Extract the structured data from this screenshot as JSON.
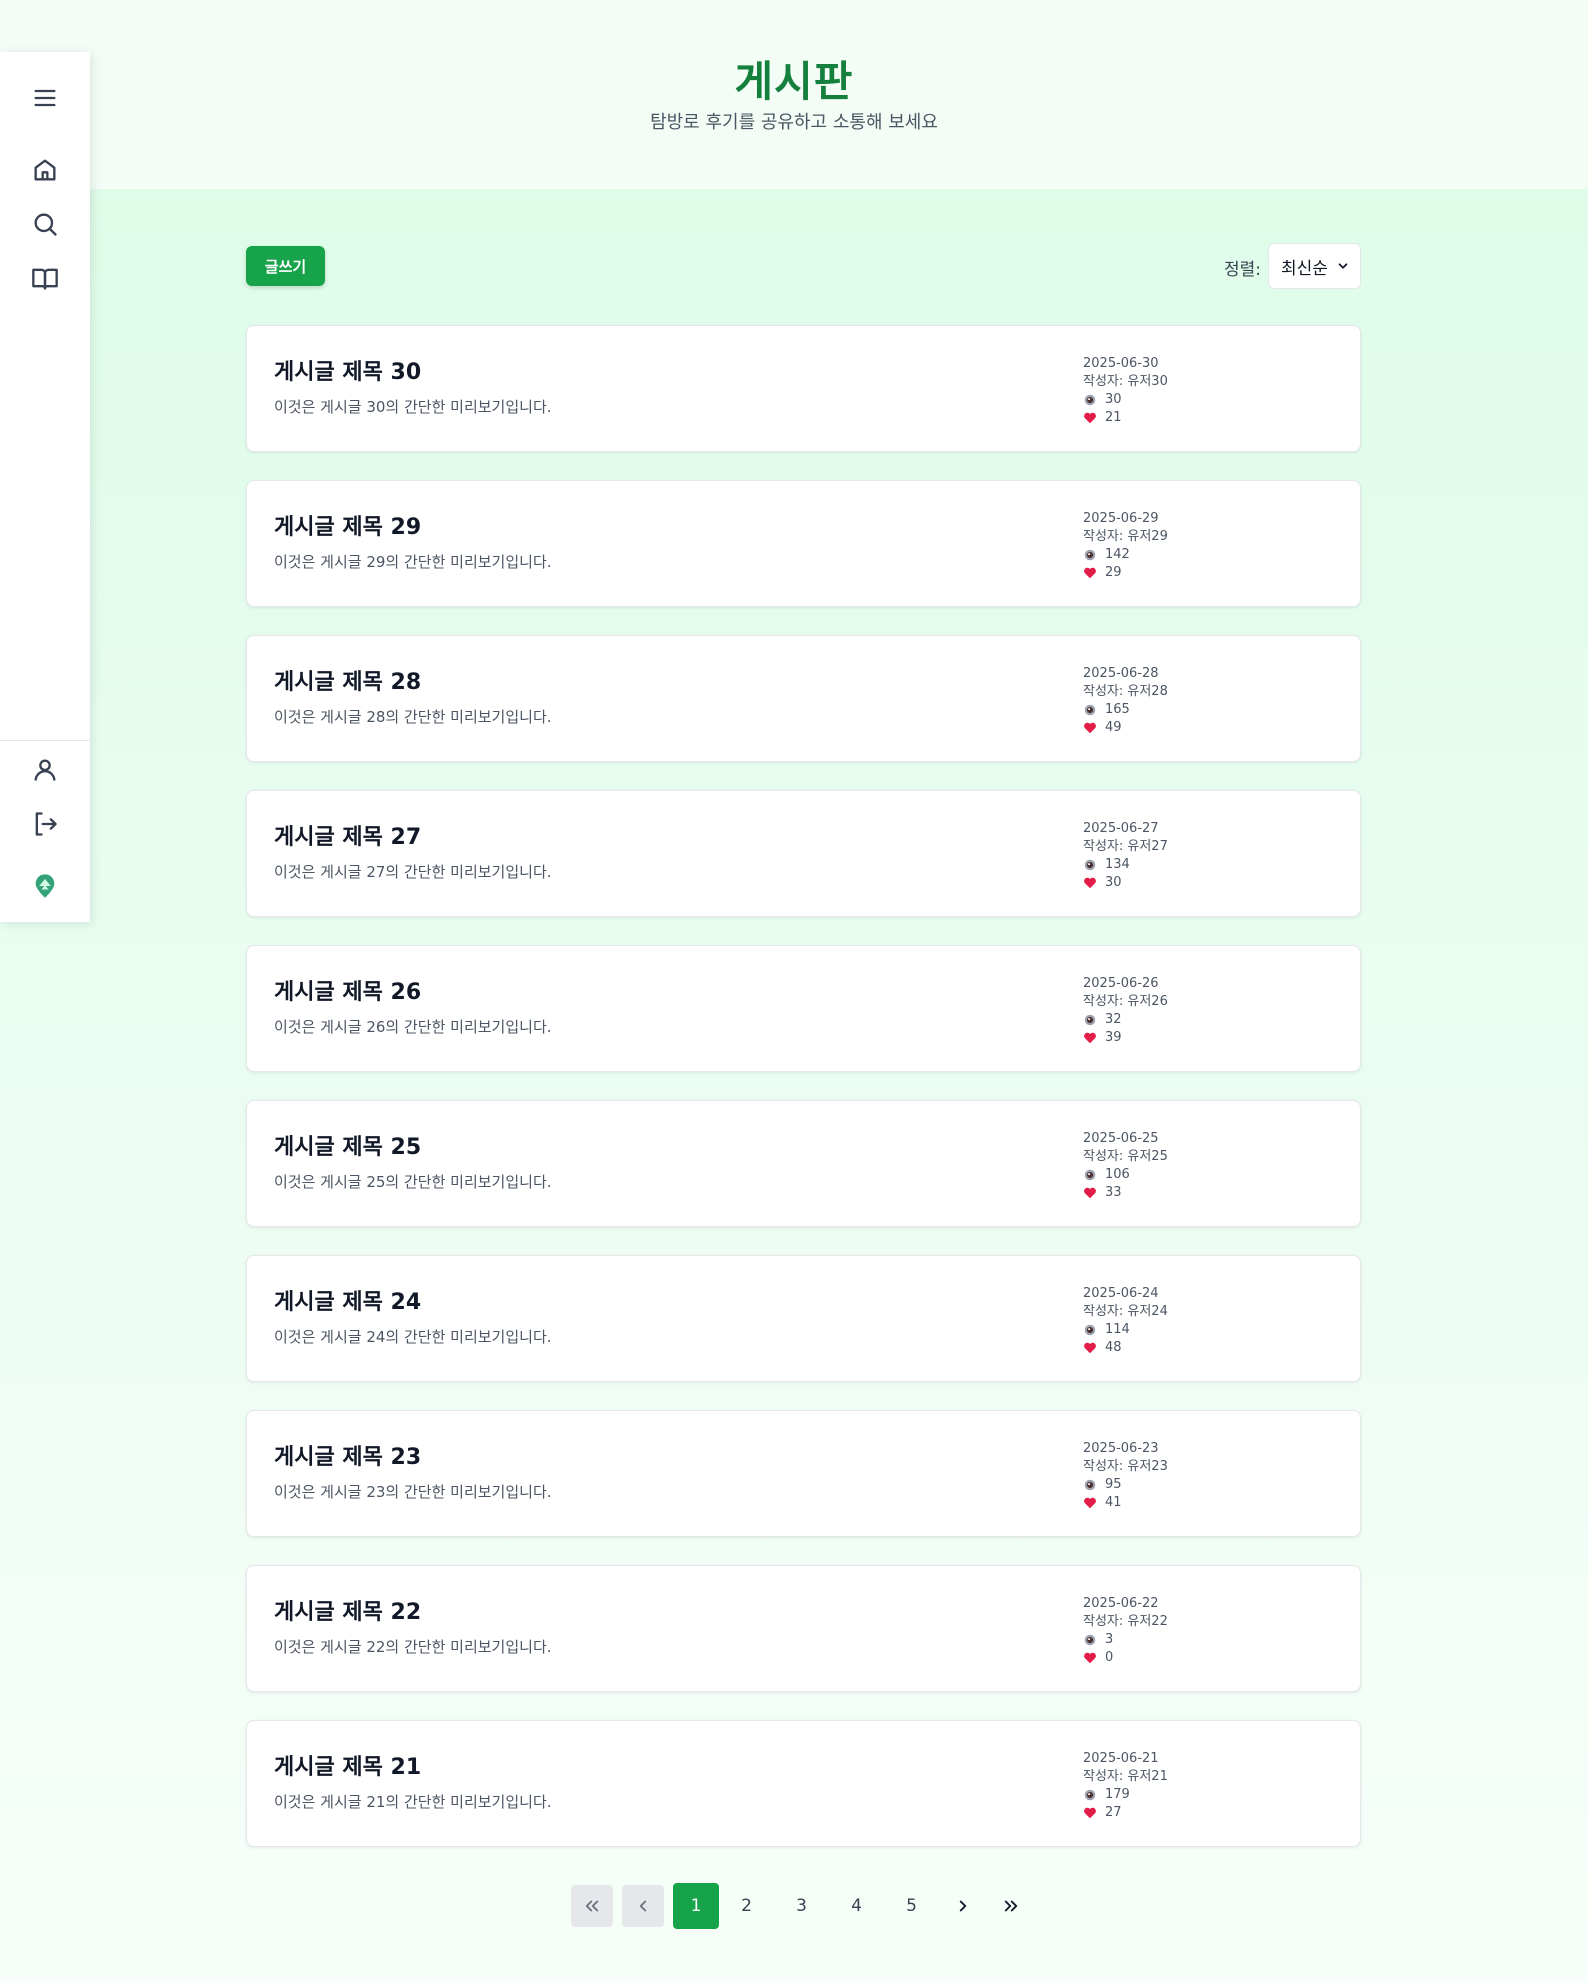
{
  "header": {
    "title": "게시판",
    "subtitle": "탐방로 후기를 공유하고 소통해 보세요"
  },
  "sidebar": {
    "top_items": [
      "menu-icon",
      "home-icon",
      "search-icon",
      "book-icon"
    ],
    "bottom_items": [
      "user-icon",
      "logout-icon",
      "logo-icon"
    ]
  },
  "toolbar": {
    "write_label": "글쓰기",
    "sort_label": "정렬:",
    "sort_value": "최신순"
  },
  "posts": [
    {
      "title": "게시글 제목 30",
      "preview": "이것은 게시글 30의 간단한 미리보기입니다.",
      "date": "2025-06-30",
      "author": "작성자: 유저30",
      "views": "30",
      "likes": "21"
    },
    {
      "title": "게시글 제목 29",
      "preview": "이것은 게시글 29의 간단한 미리보기입니다.",
      "date": "2025-06-29",
      "author": "작성자: 유저29",
      "views": "142",
      "likes": "29"
    },
    {
      "title": "게시글 제목 28",
      "preview": "이것은 게시글 28의 간단한 미리보기입니다.",
      "date": "2025-06-28",
      "author": "작성자: 유저28",
      "views": "165",
      "likes": "49"
    },
    {
      "title": "게시글 제목 27",
      "preview": "이것은 게시글 27의 간단한 미리보기입니다.",
      "date": "2025-06-27",
      "author": "작성자: 유저27",
      "views": "134",
      "likes": "30"
    },
    {
      "title": "게시글 제목 26",
      "preview": "이것은 게시글 26의 간단한 미리보기입니다.",
      "date": "2025-06-26",
      "author": "작성자: 유저26",
      "views": "32",
      "likes": "39"
    },
    {
      "title": "게시글 제목 25",
      "preview": "이것은 게시글 25의 간단한 미리보기입니다.",
      "date": "2025-06-25",
      "author": "작성자: 유저25",
      "views": "106",
      "likes": "33"
    },
    {
      "title": "게시글 제목 24",
      "preview": "이것은 게시글 24의 간단한 미리보기입니다.",
      "date": "2025-06-24",
      "author": "작성자: 유저24",
      "views": "114",
      "likes": "48"
    },
    {
      "title": "게시글 제목 23",
      "preview": "이것은 게시글 23의 간단한 미리보기입니다.",
      "date": "2025-06-23",
      "author": "작성자: 유저23",
      "views": "95",
      "likes": "41"
    },
    {
      "title": "게시글 제목 22",
      "preview": "이것은 게시글 22의 간단한 미리보기입니다.",
      "date": "2025-06-22",
      "author": "작성자: 유저22",
      "views": "3",
      "likes": "0"
    },
    {
      "title": "게시글 제목 21",
      "preview": "이것은 게시글 21의 간단한 미리보기입니다.",
      "date": "2025-06-21",
      "author": "작성자: 유저21",
      "views": "179",
      "likes": "27"
    }
  ],
  "pagination": {
    "pages": [
      "1",
      "2",
      "3",
      "4",
      "5"
    ],
    "current": "1"
  },
  "colors": {
    "accent": "#16a34a",
    "title_green": "#15803d",
    "like_red": "#e11d48"
  }
}
